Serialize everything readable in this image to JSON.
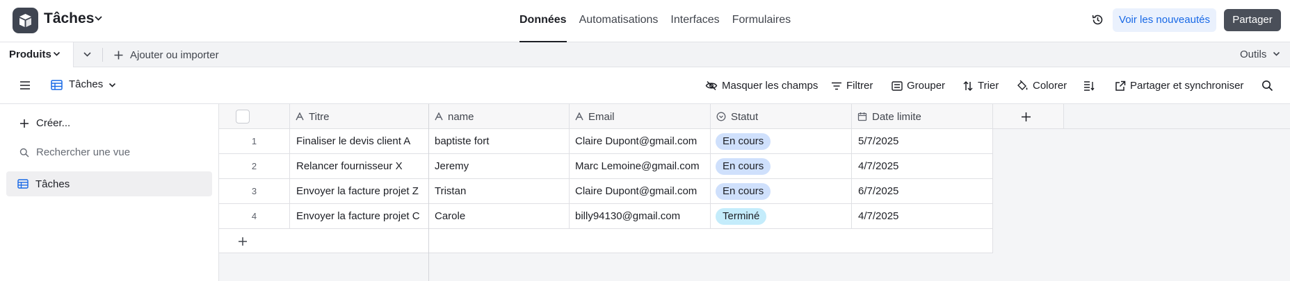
{
  "header": {
    "app_title": "Tâches",
    "nav_tabs": [
      {
        "label": "Données",
        "active": true
      },
      {
        "label": "Automatisations",
        "active": false
      },
      {
        "label": "Interfaces",
        "active": false
      },
      {
        "label": "Formulaires",
        "active": false
      }
    ],
    "whats_new_label": "Voir les nouveautés",
    "share_label": "Partager"
  },
  "tabs_bar": {
    "table_tab": "Produits",
    "add_import_label": "Ajouter ou importer",
    "tools_label": "Outils"
  },
  "view_bar": {
    "view_name": "Tâches",
    "tools": [
      {
        "label": "Masquer les champs",
        "icon": "eye-off-icon"
      },
      {
        "label": "Filtrer",
        "icon": "filter-icon"
      },
      {
        "label": "Grouper",
        "icon": "group-icon"
      },
      {
        "label": "Trier",
        "icon": "sort-icon"
      },
      {
        "label": "Colorer",
        "icon": "paint-bucket-icon"
      },
      {
        "label": "",
        "icon": "row-height-icon"
      },
      {
        "label": "Partager et synchroniser",
        "icon": "share-sync-icon"
      },
      {
        "label": "",
        "icon": "search-icon"
      }
    ]
  },
  "sidebar": {
    "create_label": "Créer...",
    "search_placeholder": "Rechercher une vue",
    "views": [
      {
        "label": "Tâches",
        "active": true
      }
    ]
  },
  "grid": {
    "columns": [
      {
        "label": "Titre",
        "icon": "text-field-icon"
      },
      {
        "label": "name",
        "icon": "text-field-icon"
      },
      {
        "label": "Email",
        "icon": "text-field-icon"
      },
      {
        "label": "Statut",
        "icon": "status-field-icon"
      },
      {
        "label": "Date limite",
        "icon": "calendar-field-icon"
      }
    ],
    "rows": [
      {
        "num": "1",
        "titre": "Finaliser le devis client A",
        "name": "baptiste fort",
        "email": "Claire Dupont@gmail.com",
        "statut": "En cours",
        "date": "5/7/2025"
      },
      {
        "num": "2",
        "titre": "Relancer fournisseur X",
        "name": "Jeremy",
        "email": "Marc Lemoine@gmail.com",
        "statut": "En cours",
        "date": "4/7/2025"
      },
      {
        "num": "3",
        "titre": "Envoyer la facture projet Z",
        "name": "Tristan",
        "email": "Claire Dupont@gmail.com",
        "statut": "En cours",
        "date": "6/7/2025"
      },
      {
        "num": "4",
        "titre": "Envoyer la facture projet C",
        "name": "Carole",
        "email": "billy94130@gmail.com",
        "statut": "Terminé",
        "date": "4/7/2025"
      }
    ],
    "status_colors": {
      "En cours": "#cfe0fc",
      "Terminé": "#c4ecfb"
    }
  },
  "colors": {
    "accent_blue": "#1768e6",
    "dark_button": "#4a4f59",
    "logo_bg": "#3f4551"
  }
}
